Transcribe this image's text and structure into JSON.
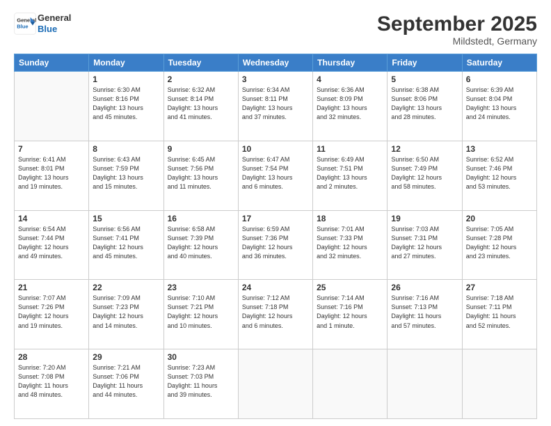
{
  "header": {
    "logo_line1": "General",
    "logo_line2": "Blue",
    "month_year": "September 2025",
    "location": "Mildstedt, Germany"
  },
  "weekdays": [
    "Sunday",
    "Monday",
    "Tuesday",
    "Wednesday",
    "Thursday",
    "Friday",
    "Saturday"
  ],
  "weeks": [
    [
      {
        "day": "",
        "info": ""
      },
      {
        "day": "1",
        "info": "Sunrise: 6:30 AM\nSunset: 8:16 PM\nDaylight: 13 hours\nand 45 minutes."
      },
      {
        "day": "2",
        "info": "Sunrise: 6:32 AM\nSunset: 8:14 PM\nDaylight: 13 hours\nand 41 minutes."
      },
      {
        "day": "3",
        "info": "Sunrise: 6:34 AM\nSunset: 8:11 PM\nDaylight: 13 hours\nand 37 minutes."
      },
      {
        "day": "4",
        "info": "Sunrise: 6:36 AM\nSunset: 8:09 PM\nDaylight: 13 hours\nand 32 minutes."
      },
      {
        "day": "5",
        "info": "Sunrise: 6:38 AM\nSunset: 8:06 PM\nDaylight: 13 hours\nand 28 minutes."
      },
      {
        "day": "6",
        "info": "Sunrise: 6:39 AM\nSunset: 8:04 PM\nDaylight: 13 hours\nand 24 minutes."
      }
    ],
    [
      {
        "day": "7",
        "info": "Sunrise: 6:41 AM\nSunset: 8:01 PM\nDaylight: 13 hours\nand 19 minutes."
      },
      {
        "day": "8",
        "info": "Sunrise: 6:43 AM\nSunset: 7:59 PM\nDaylight: 13 hours\nand 15 minutes."
      },
      {
        "day": "9",
        "info": "Sunrise: 6:45 AM\nSunset: 7:56 PM\nDaylight: 13 hours\nand 11 minutes."
      },
      {
        "day": "10",
        "info": "Sunrise: 6:47 AM\nSunset: 7:54 PM\nDaylight: 13 hours\nand 6 minutes."
      },
      {
        "day": "11",
        "info": "Sunrise: 6:49 AM\nSunset: 7:51 PM\nDaylight: 13 hours\nand 2 minutes."
      },
      {
        "day": "12",
        "info": "Sunrise: 6:50 AM\nSunset: 7:49 PM\nDaylight: 12 hours\nand 58 minutes."
      },
      {
        "day": "13",
        "info": "Sunrise: 6:52 AM\nSunset: 7:46 PM\nDaylight: 12 hours\nand 53 minutes."
      }
    ],
    [
      {
        "day": "14",
        "info": "Sunrise: 6:54 AM\nSunset: 7:44 PM\nDaylight: 12 hours\nand 49 minutes."
      },
      {
        "day": "15",
        "info": "Sunrise: 6:56 AM\nSunset: 7:41 PM\nDaylight: 12 hours\nand 45 minutes."
      },
      {
        "day": "16",
        "info": "Sunrise: 6:58 AM\nSunset: 7:39 PM\nDaylight: 12 hours\nand 40 minutes."
      },
      {
        "day": "17",
        "info": "Sunrise: 6:59 AM\nSunset: 7:36 PM\nDaylight: 12 hours\nand 36 minutes."
      },
      {
        "day": "18",
        "info": "Sunrise: 7:01 AM\nSunset: 7:33 PM\nDaylight: 12 hours\nand 32 minutes."
      },
      {
        "day": "19",
        "info": "Sunrise: 7:03 AM\nSunset: 7:31 PM\nDaylight: 12 hours\nand 27 minutes."
      },
      {
        "day": "20",
        "info": "Sunrise: 7:05 AM\nSunset: 7:28 PM\nDaylight: 12 hours\nand 23 minutes."
      }
    ],
    [
      {
        "day": "21",
        "info": "Sunrise: 7:07 AM\nSunset: 7:26 PM\nDaylight: 12 hours\nand 19 minutes."
      },
      {
        "day": "22",
        "info": "Sunrise: 7:09 AM\nSunset: 7:23 PM\nDaylight: 12 hours\nand 14 minutes."
      },
      {
        "day": "23",
        "info": "Sunrise: 7:10 AM\nSunset: 7:21 PM\nDaylight: 12 hours\nand 10 minutes."
      },
      {
        "day": "24",
        "info": "Sunrise: 7:12 AM\nSunset: 7:18 PM\nDaylight: 12 hours\nand 6 minutes."
      },
      {
        "day": "25",
        "info": "Sunrise: 7:14 AM\nSunset: 7:16 PM\nDaylight: 12 hours\nand 1 minute."
      },
      {
        "day": "26",
        "info": "Sunrise: 7:16 AM\nSunset: 7:13 PM\nDaylight: 11 hours\nand 57 minutes."
      },
      {
        "day": "27",
        "info": "Sunrise: 7:18 AM\nSunset: 7:11 PM\nDaylight: 11 hours\nand 52 minutes."
      }
    ],
    [
      {
        "day": "28",
        "info": "Sunrise: 7:20 AM\nSunset: 7:08 PM\nDaylight: 11 hours\nand 48 minutes."
      },
      {
        "day": "29",
        "info": "Sunrise: 7:21 AM\nSunset: 7:06 PM\nDaylight: 11 hours\nand 44 minutes."
      },
      {
        "day": "30",
        "info": "Sunrise: 7:23 AM\nSunset: 7:03 PM\nDaylight: 11 hours\nand 39 minutes."
      },
      {
        "day": "",
        "info": ""
      },
      {
        "day": "",
        "info": ""
      },
      {
        "day": "",
        "info": ""
      },
      {
        "day": "",
        "info": ""
      }
    ]
  ]
}
